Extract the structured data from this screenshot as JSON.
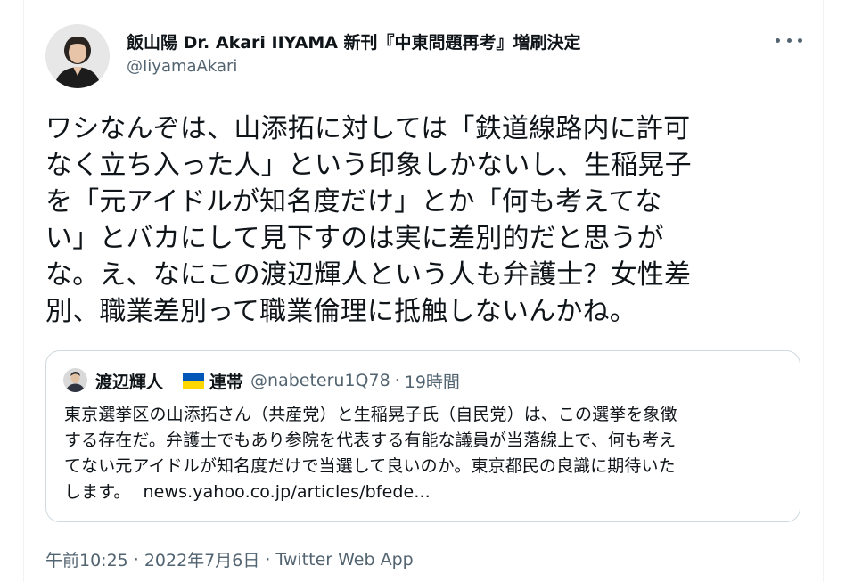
{
  "author": {
    "display_name": "飯山陽 Dr. Akari IIYAMA 新刊『中東問題再考』増刷決定",
    "handle": "@IiyamaAkari",
    "avatar_icon": "profile-photo"
  },
  "more_icon": "more-horizontal-icon",
  "tweet": {
    "lines": [
      "ワシなんぞは、山添拓に対しては「鉄道線路内に許可",
      "なく立ち入った人」という印象しかないし、生稲晃子",
      "を「元アイドルが知名度だけ」とか「何も考えてな",
      "い」とバカにして見下すのは実に差別的だと思うが",
      "な。え、なにこの渡辺輝人という人も弁護士？女性差",
      "別、職業差別って職業倫理に抵触しないんかね。"
    ]
  },
  "quoted": {
    "display_name": "渡辺輝人",
    "flag_icon": "ukraine-flag",
    "name_suffix": "連帯",
    "handle": "@nabeteru1Q78",
    "separator": "·",
    "time": "19時間",
    "lines": [
      "東京選挙区の山添拓さん（共産党）と生稲晃子氏（自民党）は、この選挙を象徴",
      "する存在だ。弁護士でもあり参院を代表する有能な議員が当落線上で、何も考え",
      "てない元アイドルが知名度だけで当選して良いのか。東京都民の良識に期待いた",
      "します。"
    ],
    "link": "news.yahoo.co.jp/articles/bfede..."
  },
  "meta": {
    "time": "午前10:25",
    "sep1": "·",
    "date": "2022年7月6日",
    "sep2": "·",
    "source": "Twitter Web App"
  },
  "colors": {
    "text": "#0f1419",
    "secondary": "#536471",
    "border": "#cfd9de",
    "flag_blue": "#0057b7",
    "flag_yellow": "#ffd700"
  }
}
